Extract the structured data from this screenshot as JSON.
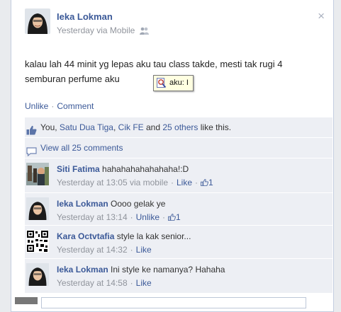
{
  "post": {
    "poster_name": "Ieka Lokman",
    "meta": "Yesterday via Mobile",
    "close_glyph": "×",
    "text": "kalau lah 44 minit yg lepas aku tau class takde, mesti tak rugi 4 semburan perfume aku"
  },
  "tooltip": {
    "text": "aku: I"
  },
  "actions": {
    "unlike": "Unlike",
    "comment": "Comment",
    "separator": "·"
  },
  "likes": {
    "you": "You, ",
    "friend1": "Satu Dua Tiga",
    "comma": ", ",
    "friend2": "Cik FE",
    "and": " and ",
    "others": "25 others",
    "tail": " like this."
  },
  "view_all": {
    "label": "View all 25 comments"
  },
  "comments": [
    {
      "name": "Siti Fatima",
      "text": "hahahahahahahaha!:D",
      "time": "Yesterday at 13:05 via mobile",
      "like_label": "Like",
      "like_count": "1"
    },
    {
      "name": "Ieka Lokman",
      "text": "Oooo gelak ye",
      "time": "Yesterday at 13:14",
      "like_label": "Unlike",
      "like_count": "1"
    },
    {
      "name": "Kara Octvtafia",
      "text": "style la kak senior...",
      "time": "Yesterday at 14:32",
      "like_label": "Like"
    },
    {
      "name": "Ieka Lokman",
      "text": "Ini style ke namanya? Hahaha",
      "time": "Yesterday at 14:58",
      "like_label": "Like"
    }
  ],
  "colors": {
    "link": "#3b5998",
    "ufi_bg": "#edeff4",
    "meta": "#90949c"
  },
  "icons": [
    "close-icon",
    "friends-audience-icon",
    "magnifier-tooltip-icon",
    "thumbs-up-icon",
    "comment-bubble-icon"
  ]
}
